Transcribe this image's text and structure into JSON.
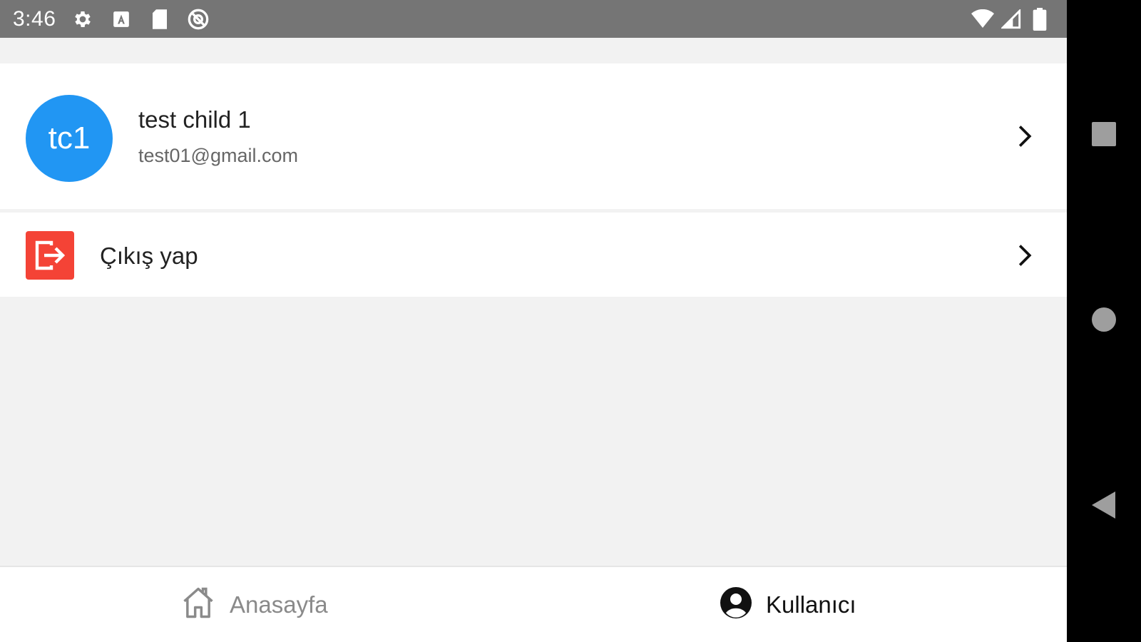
{
  "status_bar": {
    "time": "3:46",
    "left_icons": [
      "settings-icon",
      "font-icon",
      "sd-card-icon",
      "at-sign-icon"
    ],
    "right_icons": [
      "wifi-icon",
      "signal-icon",
      "battery-icon"
    ]
  },
  "profile": {
    "avatar_initials": "tc1",
    "avatar_color": "#2196f3",
    "name": "test child 1",
    "email": "test01@gmail.com"
  },
  "logout": {
    "label": "Çıkış yap",
    "icon_color": "#f44336"
  },
  "tabs": [
    {
      "label": "Anasayfa",
      "icon": "home-icon",
      "active": false
    },
    {
      "label": "Kullanıcı",
      "icon": "user-icon",
      "active": true
    }
  ],
  "nav_bar": [
    "recents-button",
    "home-button",
    "back-button"
  ]
}
